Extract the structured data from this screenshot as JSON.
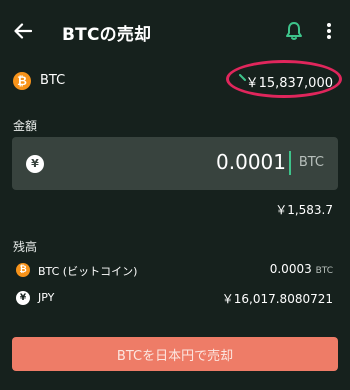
{
  "header": {
    "title": "BTCの売却"
  },
  "price_row": {
    "coin_symbol": "₿",
    "asset": "BTC",
    "price": "￥15,837,000",
    "highlight_color": "#e0265c"
  },
  "amount": {
    "label": "金額",
    "currency_symbol": "¥",
    "value": "0.0001",
    "unit": "BTC",
    "converted": "￥1,583.7"
  },
  "balance": {
    "label": "残高",
    "rows": [
      {
        "coin_symbol": "₿",
        "name": "BTC (ビットコイン)",
        "value": "0.0003",
        "unit": "BTC"
      },
      {
        "coin_symbol": "¥",
        "name": "JPY",
        "value": "￥16,017.8080721",
        "unit": ""
      }
    ]
  },
  "action": {
    "sell_label": "BTCを日本円で売却",
    "color": "#ee7c67"
  },
  "icons": {
    "back": "arrow-left-icon",
    "bell": "bell-icon",
    "more": "more-vertical-icon"
  },
  "colors": {
    "background": "#16211d",
    "accent_green": "#3ec48b",
    "btc_orange": "#f7931a"
  }
}
